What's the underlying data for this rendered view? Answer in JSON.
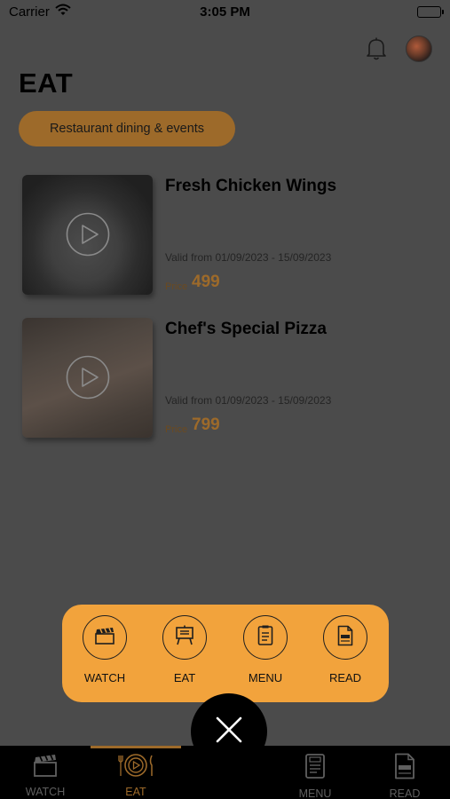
{
  "status_bar": {
    "carrier": "Carrier",
    "time": "3:05 PM"
  },
  "header": {
    "title": "EAT",
    "category_label": "Restaurant dining & events"
  },
  "items": [
    {
      "title": "Fresh Chicken Wings",
      "valid": "Valid from 01/09/2023 - 15/09/2023",
      "price_label": "Price",
      "price": "499"
    },
    {
      "title": "Chef's Special Pizza",
      "valid": "Valid from 01/09/2023 - 15/09/2023",
      "price_label": "Price",
      "price": "799"
    }
  ],
  "quick_actions": [
    {
      "label": "WATCH",
      "icon": "clapperboard-icon"
    },
    {
      "label": "EAT",
      "icon": "food-board-icon"
    },
    {
      "label": "MENU",
      "icon": "menu-card-icon"
    },
    {
      "label": "READ",
      "icon": "document-icon"
    }
  ],
  "tab_bar": {
    "tabs": [
      {
        "label": "WATCH",
        "icon": "clapperboard-icon"
      },
      {
        "label": "EAT",
        "icon": "plate-cutlery-icon",
        "active": true
      },
      {
        "label": "MENU",
        "icon": "menu-card-icon"
      },
      {
        "label": "READ",
        "icon": "document-icon"
      }
    ]
  },
  "colors": {
    "accent": "#f2a33c",
    "accent_dimmed": "#9d6a2a",
    "overlay": "#4b4b4b",
    "tab_bar": "#000000"
  }
}
